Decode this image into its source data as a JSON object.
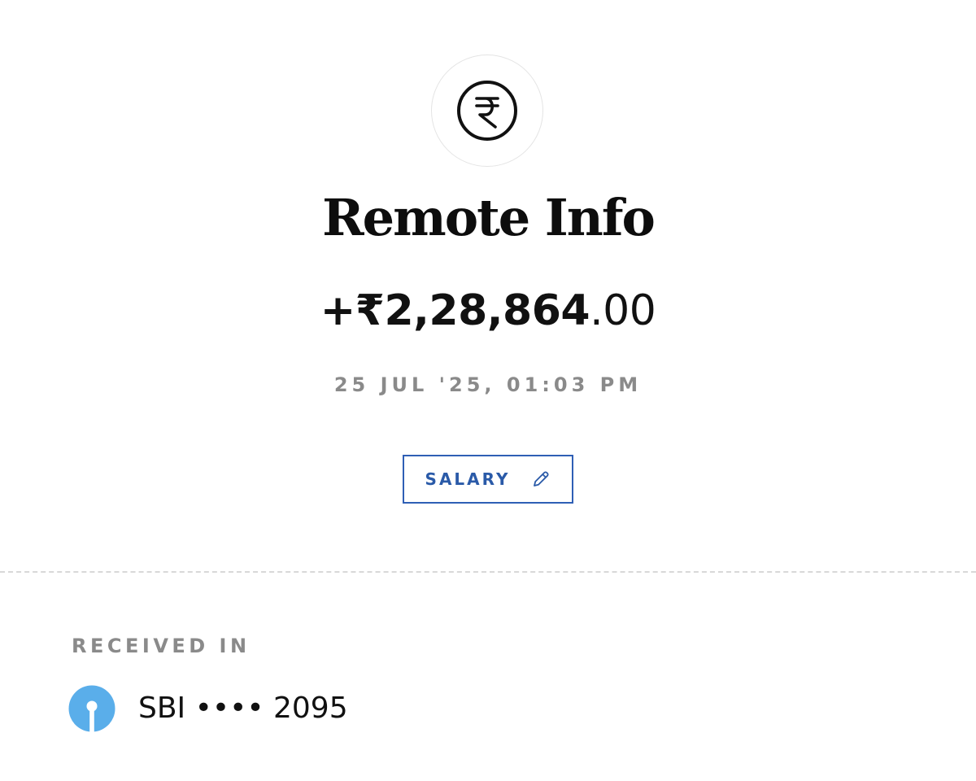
{
  "transaction": {
    "icon": "rupee-icon",
    "title": "Remote Info",
    "amount_main": "+₹2,28,864",
    "amount_decimal": ".00",
    "datetime": "25 JUL '25, 01:03 PM",
    "category_tag": "SALARY",
    "category_edit_icon": "pencil-icon"
  },
  "received_in": {
    "label": "RECEIVED IN",
    "bank_icon": "sbi-logo-icon",
    "account": "SBI •••• 2095"
  },
  "colors": {
    "accent": "#2f5fb5",
    "sbi_logo": "#5aaeea",
    "muted_text": "#8a8a8a",
    "divider": "#d8d8d8"
  }
}
